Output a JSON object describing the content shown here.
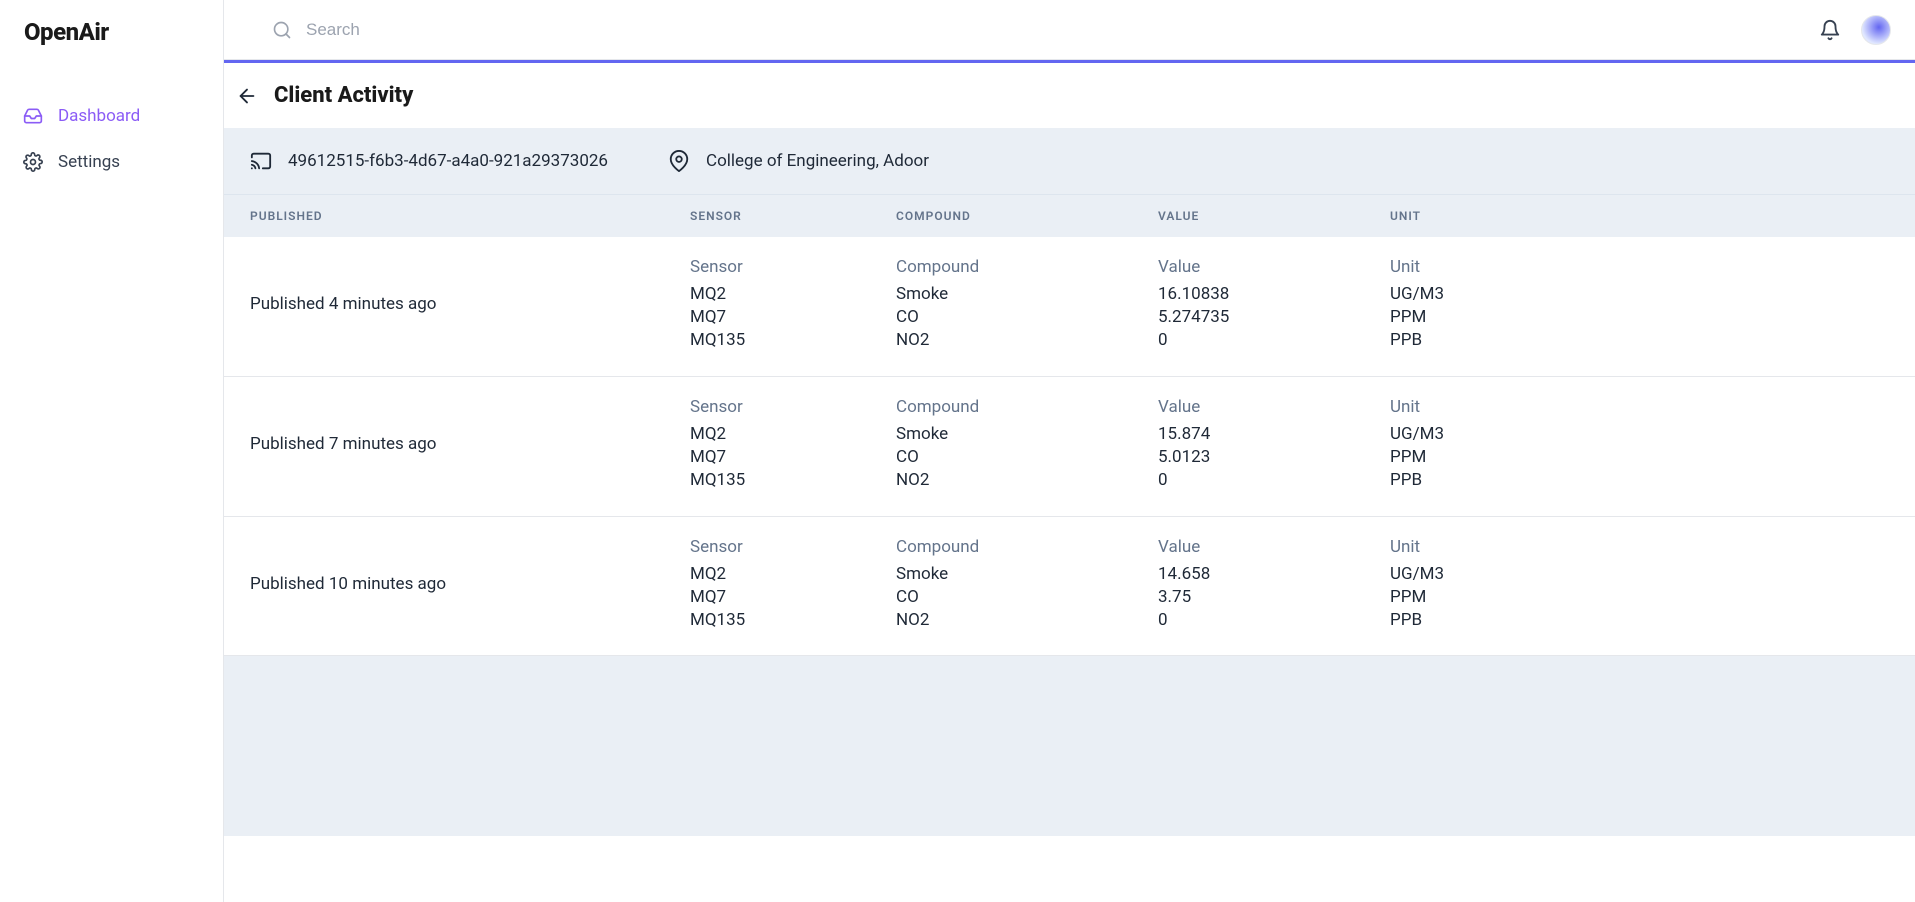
{
  "app": {
    "name": "OpenAir"
  },
  "search": {
    "placeholder": "Search"
  },
  "sidebar": {
    "items": [
      {
        "label": "Dashboard"
      },
      {
        "label": "Settings"
      }
    ]
  },
  "page": {
    "title": "Client Activity",
    "client_id": "49612515-f6b3-4d67-a4a0-921a29373026",
    "location": "College of Engineering, Adoor"
  },
  "table": {
    "headers": {
      "published": "PUBLISHED",
      "sensor": "SENSOR",
      "compound": "COMPOUND",
      "value": "VALUE",
      "unit": "UNIT"
    },
    "row_labels": {
      "sensor": "Sensor",
      "compound": "Compound",
      "value": "Value",
      "unit": "Unit"
    },
    "rows": [
      {
        "published": "Published 4 minutes ago",
        "readings": [
          {
            "sensor": "MQ2",
            "compound": "Smoke",
            "value": "16.10838",
            "unit": "UG/M3"
          },
          {
            "sensor": "MQ7",
            "compound": "CO",
            "value": "5.274735",
            "unit": "PPM"
          },
          {
            "sensor": "MQ135",
            "compound": "NO2",
            "value": "0",
            "unit": "PPB"
          }
        ]
      },
      {
        "published": "Published 7 minutes ago",
        "readings": [
          {
            "sensor": "MQ2",
            "compound": "Smoke",
            "value": "15.874",
            "unit": "UG/M3"
          },
          {
            "sensor": "MQ7",
            "compound": "CO",
            "value": "5.0123",
            "unit": "PPM"
          },
          {
            "sensor": "MQ135",
            "compound": "NO2",
            "value": "0",
            "unit": "PPB"
          }
        ]
      },
      {
        "published": "Published 10 minutes ago",
        "readings": [
          {
            "sensor": "MQ2",
            "compound": "Smoke",
            "value": "14.658",
            "unit": "UG/M3"
          },
          {
            "sensor": "MQ7",
            "compound": "CO",
            "value": "3.75",
            "unit": "PPM"
          },
          {
            "sensor": "MQ135",
            "compound": "NO2",
            "value": "0",
            "unit": "PPB"
          }
        ]
      }
    ]
  }
}
